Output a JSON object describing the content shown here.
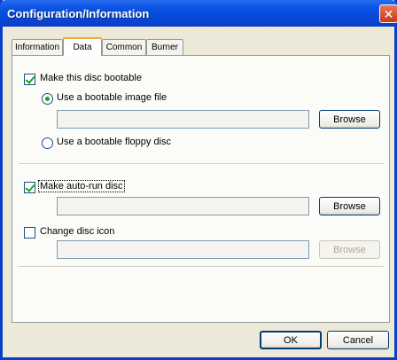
{
  "window": {
    "title": "Configuration/Information"
  },
  "tabs": [
    {
      "label": "Information",
      "active": false
    },
    {
      "label": "Data",
      "active": true
    },
    {
      "label": "Common",
      "active": false
    },
    {
      "label": "Burner",
      "active": false
    }
  ],
  "bootable": {
    "checkbox_label": "Make this disc bootable",
    "checked": true,
    "image_option_label": "Use a bootable image file",
    "image_selected": true,
    "image_path": "",
    "image_browse_label": "Browse",
    "floppy_option_label": "Use a bootable floppy disc",
    "floppy_selected": false
  },
  "autorun": {
    "checkbox_label": "Make auto-run disc",
    "checked": true,
    "path": "",
    "browse_label": "Browse"
  },
  "disc_icon": {
    "checkbox_label": "Change disc icon",
    "checked": false,
    "path": "",
    "browse_label": "Browse",
    "browse_enabled": false
  },
  "footer": {
    "ok_label": "OK",
    "cancel_label": "Cancel"
  },
  "colors": {
    "titlebar": "#0A54E4",
    "face": "#ECE9D8",
    "check_mark": "#21A121",
    "active_tab_accent": "#F4A73B"
  }
}
